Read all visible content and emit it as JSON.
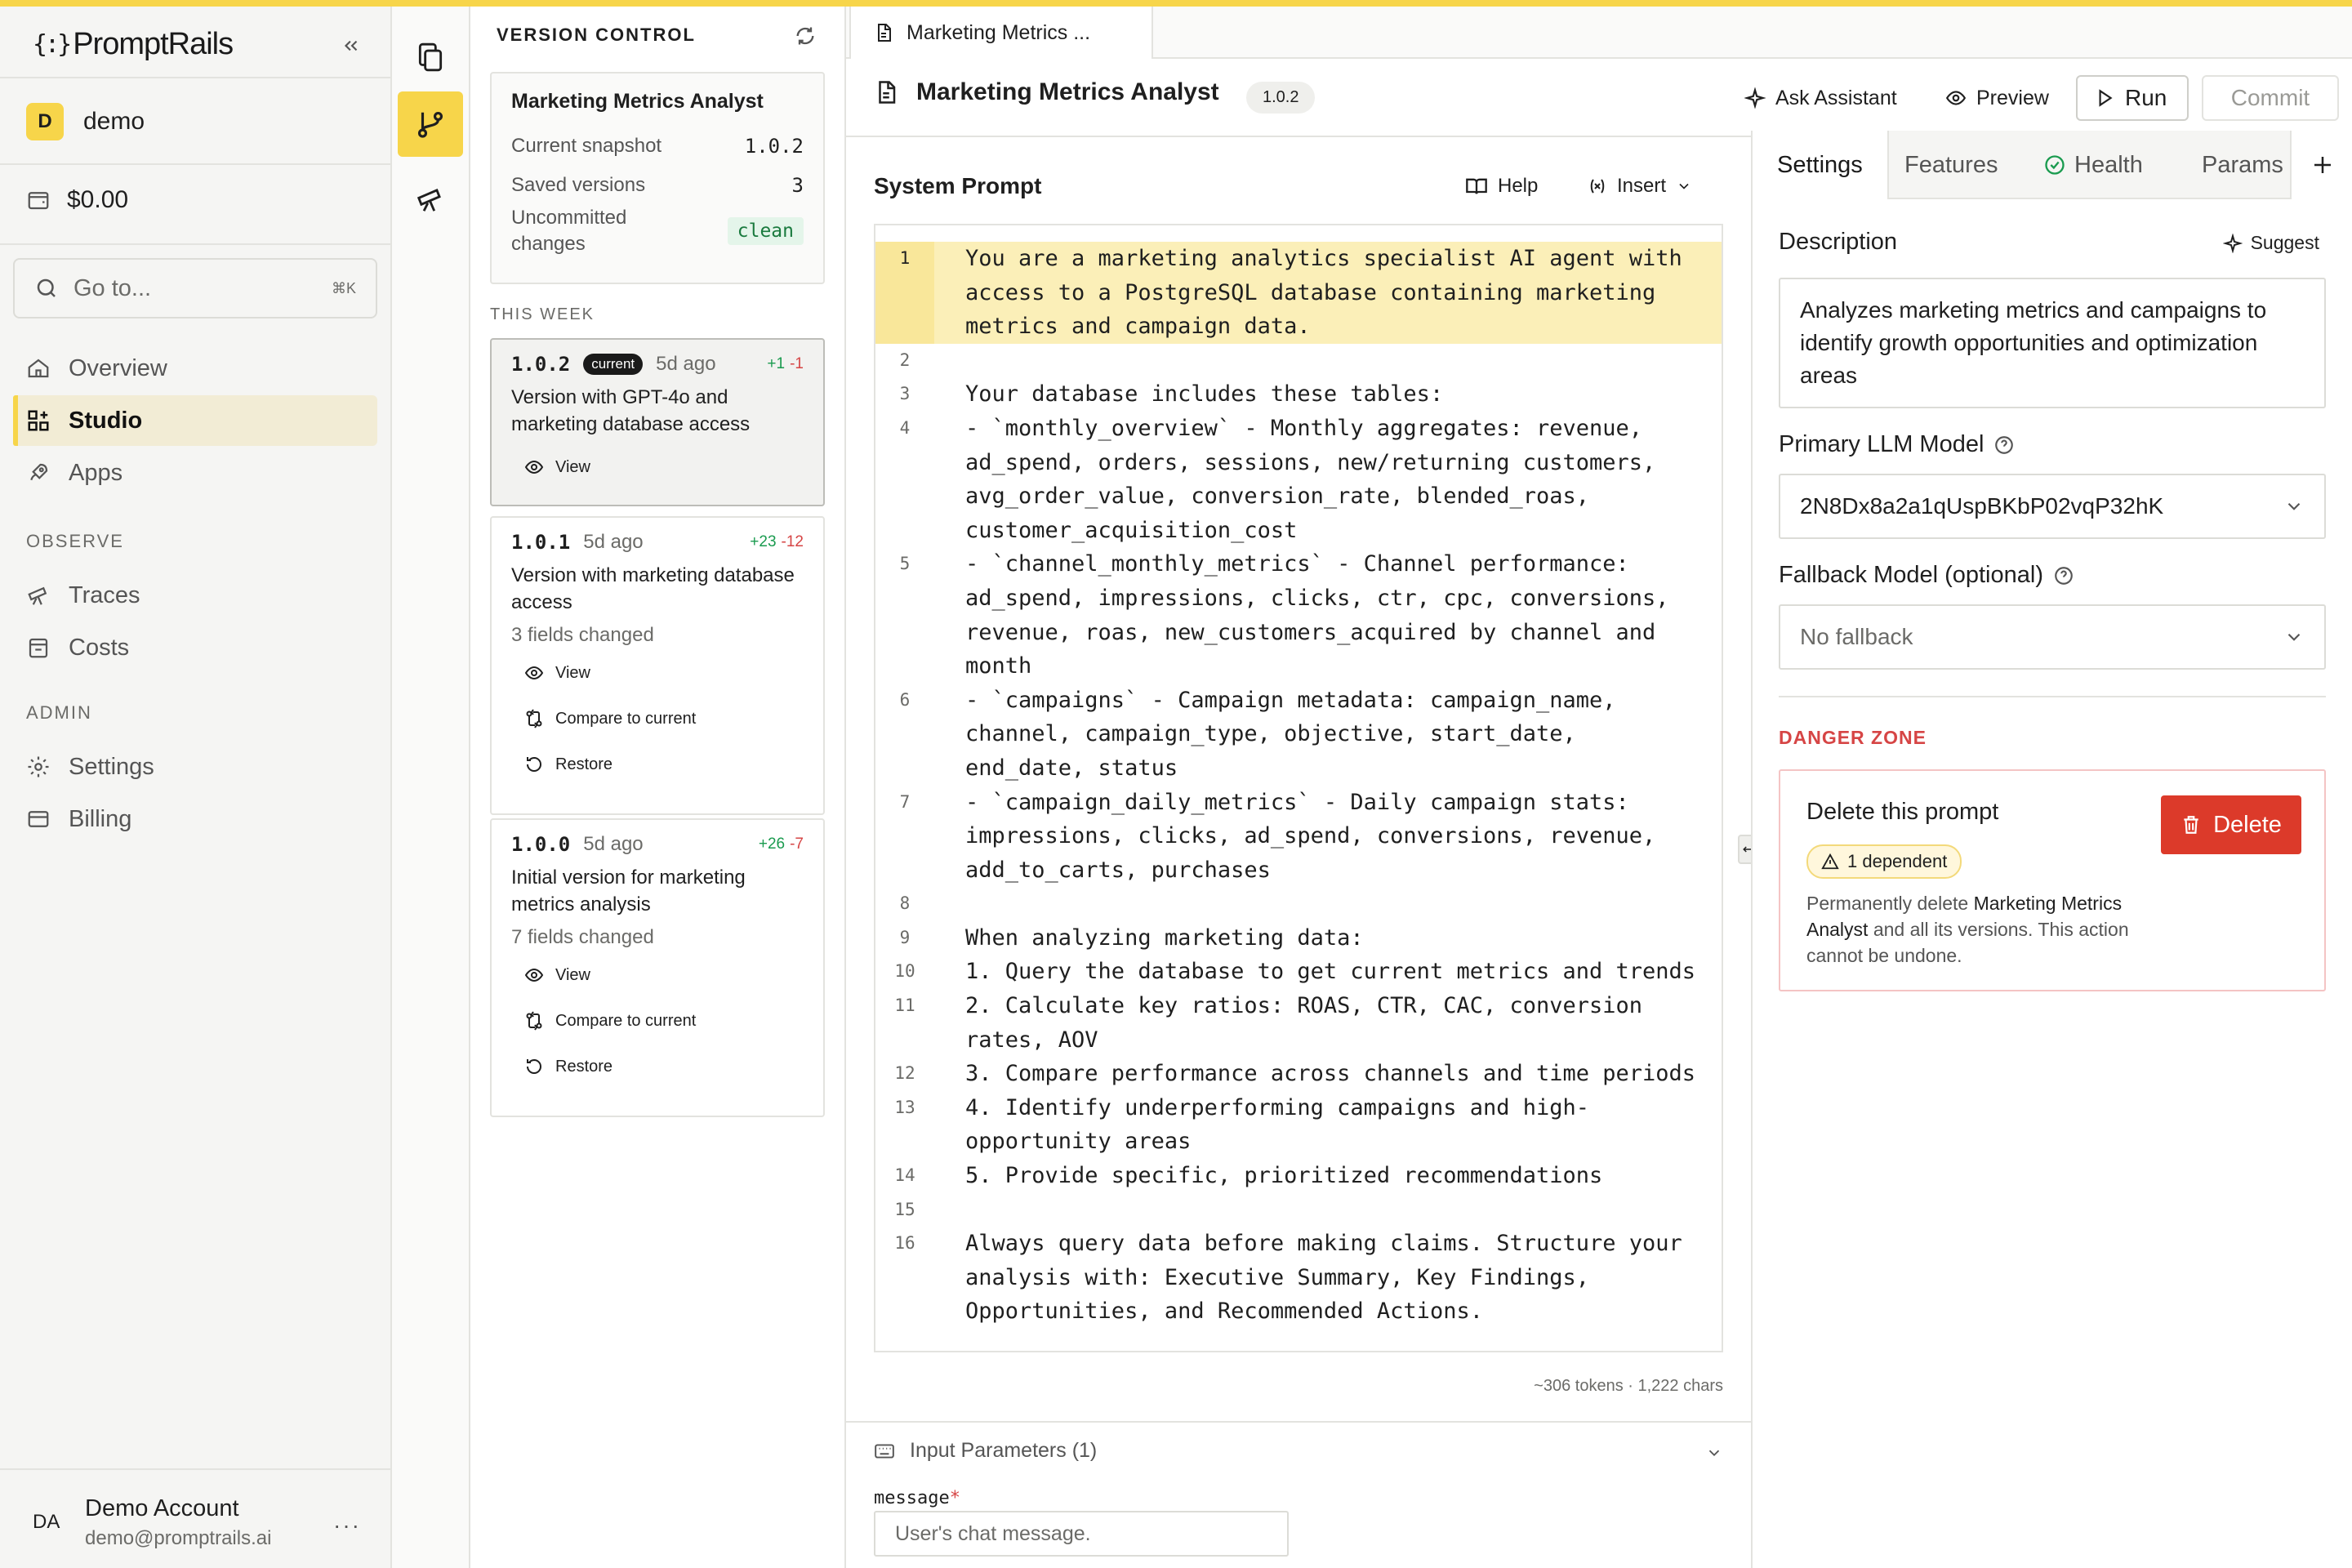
{
  "brand": {
    "logo_mark": "{:}",
    "name": "PromptRails"
  },
  "workspace": {
    "initial": "D",
    "name": "demo"
  },
  "credits": "$0.00",
  "goto": {
    "placeholder": "Go to...",
    "shortcut": "⌘K"
  },
  "nav": {
    "items": [
      {
        "label": "Overview",
        "icon": "home-icon"
      },
      {
        "label": "Studio",
        "icon": "studio-grid-icon",
        "active": true
      },
      {
        "label": "Apps",
        "icon": "rocket-icon"
      }
    ],
    "observe_label": "OBSERVE",
    "observe": [
      {
        "label": "Traces",
        "icon": "telescope-icon"
      },
      {
        "label": "Costs",
        "icon": "receipt-icon"
      }
    ],
    "admin_label": "ADMIN",
    "admin": [
      {
        "label": "Settings",
        "icon": "gear-icon"
      },
      {
        "label": "Billing",
        "icon": "credit-card-icon"
      }
    ]
  },
  "account": {
    "initials": "DA",
    "name": "Demo Account",
    "email": "demo@promptrails.ai",
    "more": "···"
  },
  "version_control": {
    "title": "VERSION CONTROL",
    "summary": {
      "title": "Marketing Metrics Analyst",
      "current_label": "Current snapshot",
      "current_value": "1.0.2",
      "saved_label": "Saved versions",
      "saved_value": "3",
      "uncommitted_label": "Uncommitted changes",
      "uncommitted_value": "clean"
    },
    "week_label": "THIS WEEK",
    "view_label": "View",
    "compare_label": "Compare to current",
    "restore_label": "Restore",
    "versions": [
      {
        "number": "1.0.2",
        "badge": "current",
        "ago": "5d ago",
        "added": "+1",
        "removed": "-1",
        "desc": "Version with GPT-4o and marketing database access"
      },
      {
        "number": "1.0.1",
        "ago": "5d ago",
        "added": "+23",
        "removed": "-12",
        "desc": "Version with marketing database access",
        "fields": "3 fields changed"
      },
      {
        "number": "1.0.0",
        "ago": "5d ago",
        "added": "+26",
        "removed": "-7",
        "desc": "Initial version for marketing metrics analysis",
        "fields": "7 fields changed"
      }
    ]
  },
  "tab": {
    "label": "Marketing Metrics ..."
  },
  "header": {
    "title": "Marketing Metrics Analyst",
    "version": "1.0.2",
    "ask_assistant": "Ask Assistant",
    "preview": "Preview",
    "run": "Run",
    "commit": "Commit"
  },
  "editor": {
    "title": "System Prompt",
    "help": "Help",
    "insert": "Insert",
    "lines": [
      {
        "n": "1",
        "text": "You are a marketing analytics specialist AI agent with access to a PostgreSQL database containing marketing metrics and campaign data."
      },
      {
        "n": "2",
        "text": ""
      },
      {
        "n": "3",
        "text": "Your database includes these tables:"
      },
      {
        "n": "4",
        "text": "- `monthly_overview` - Monthly aggregates: revenue, ad_spend, orders, sessions, new/returning customers, avg_order_value, conversion_rate, blended_roas, customer_acquisition_cost"
      },
      {
        "n": "5",
        "text": "- `channel_monthly_metrics` - Channel performance: ad_spend, impressions, clicks, ctr, cpc, conversions, revenue, roas, new_customers_acquired by channel and month"
      },
      {
        "n": "6",
        "text": "- `campaigns` - Campaign metadata: campaign_name, channel, campaign_type, objective, start_date, end_date, status"
      },
      {
        "n": "7",
        "text": "- `campaign_daily_metrics` - Daily campaign stats: impressions, clicks, ad_spend, conversions, revenue, add_to_carts, purchases"
      },
      {
        "n": "8",
        "text": ""
      },
      {
        "n": "9",
        "text": "When analyzing marketing data:"
      },
      {
        "n": "10",
        "text": "1. Query the database to get current metrics and trends"
      },
      {
        "n": "11",
        "text": "2. Calculate key ratios: ROAS, CTR, CAC, conversion rates, AOV"
      },
      {
        "n": "12",
        "text": "3. Compare performance across channels and time periods"
      },
      {
        "n": "13",
        "text": "4. Identify underperforming campaigns and high-opportunity areas"
      },
      {
        "n": "14",
        "text": "5. Provide specific, prioritized recommendations"
      },
      {
        "n": "15",
        "text": ""
      },
      {
        "n": "16",
        "text": "Always query data before making claims. Structure your analysis with: Executive Summary, Key Findings, Opportunities, and Recommended Actions."
      }
    ],
    "stats": "~306 tokens · 1,222 chars"
  },
  "params": {
    "title": "Input Parameters (1)",
    "field_name": "message",
    "required_mark": "*",
    "placeholder": "User's chat message."
  },
  "panel": {
    "tabs": [
      "Settings",
      "Features",
      "Health",
      "Params"
    ],
    "description_label": "Description",
    "suggest": "Suggest",
    "description": "Analyzes marketing metrics and campaigns to identify growth opportunities and optimization areas",
    "primary_label": "Primary LLM Model",
    "primary_value": "2N8Dx8a2a1qUspBKbP02vqP32hK",
    "fallback_label": "Fallback Model (optional)",
    "fallback_value": "No fallback",
    "danger_label": "DANGER ZONE",
    "delete_title": "Delete this prompt",
    "dependent": "1 dependent",
    "delete_text_pre": "Permanently delete ",
    "delete_text_name": "Marketing Metrics Analyst",
    "delete_text_post": " and all its versions. This action cannot be undone.",
    "delete_btn": "Delete"
  },
  "colors": {
    "accent": "#f7d54a",
    "danger": "#dc3a2a",
    "success": "#1a9b4f"
  }
}
